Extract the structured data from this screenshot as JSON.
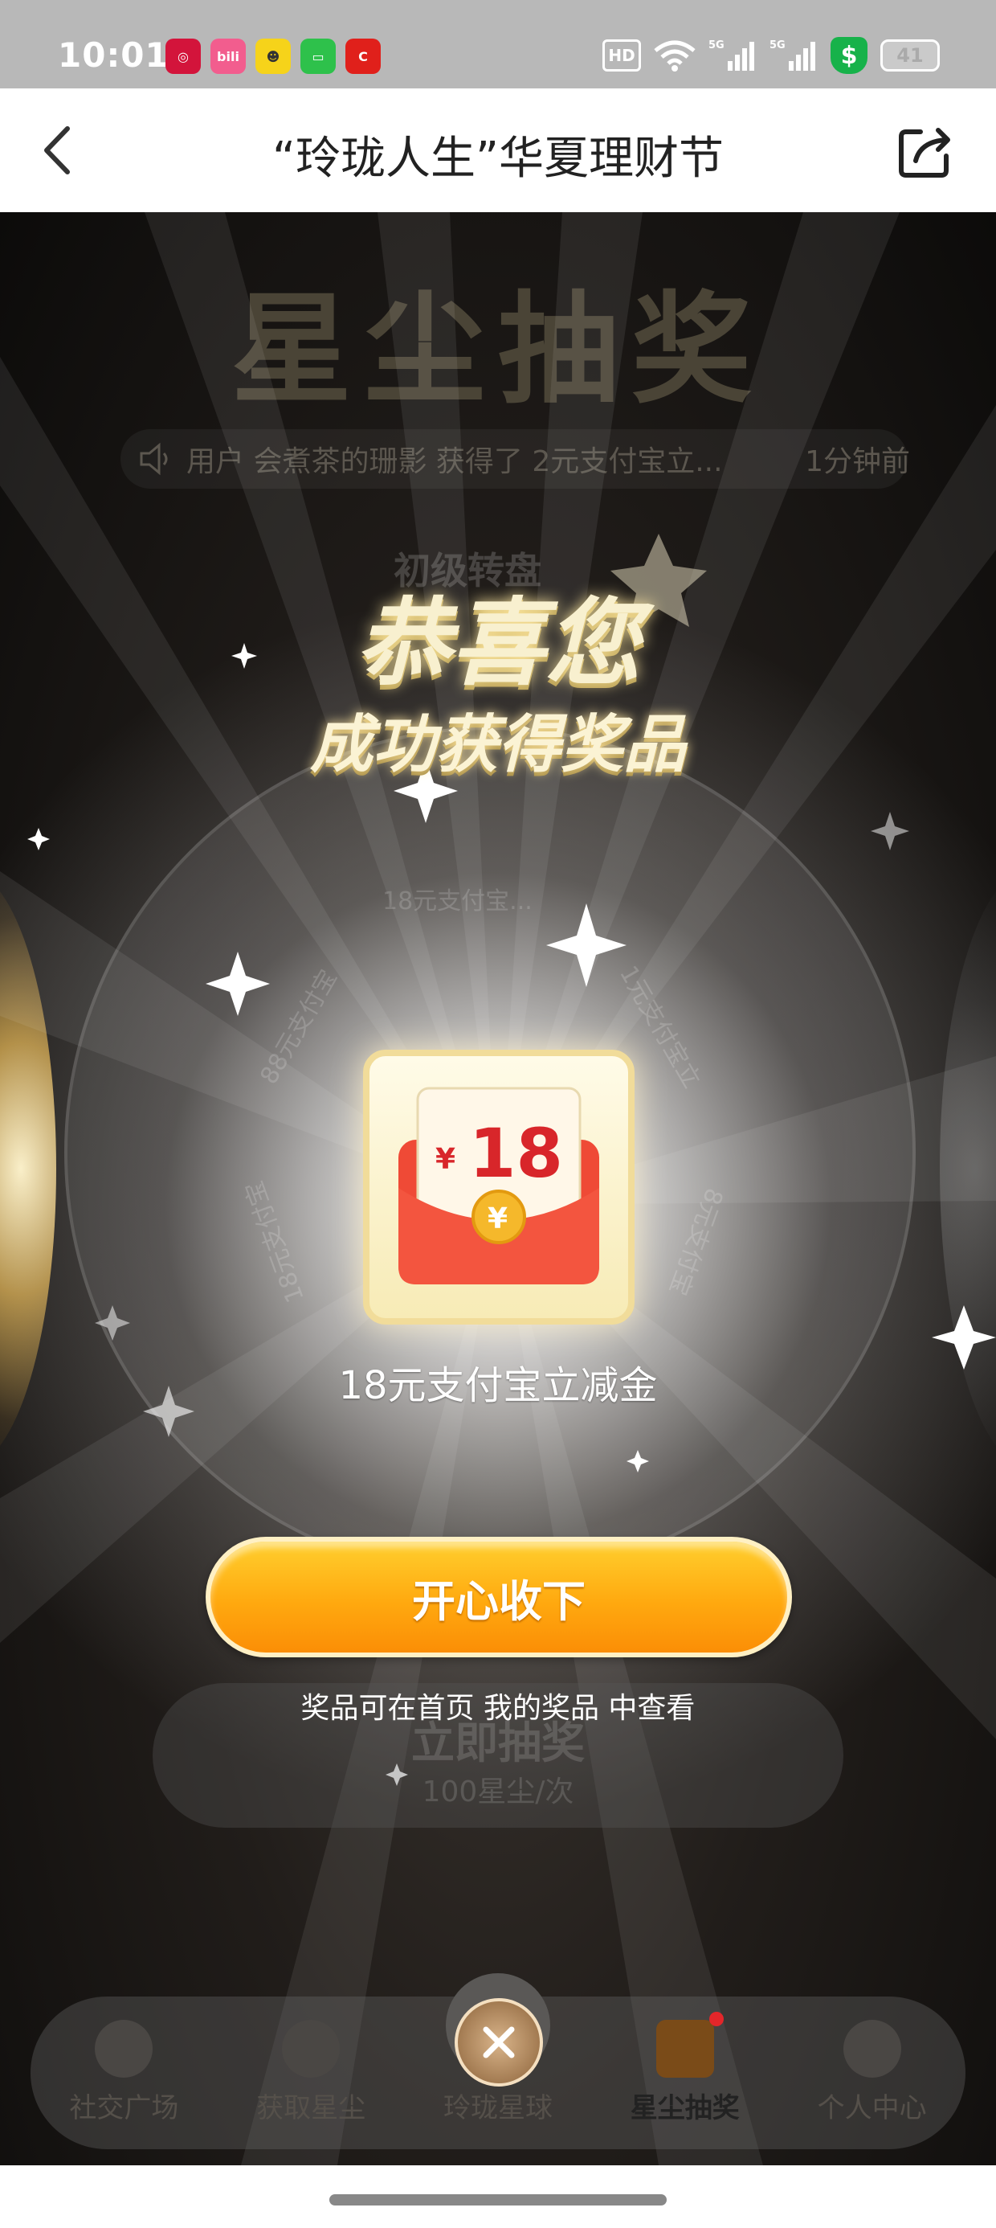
{
  "status_bar": {
    "time": "10:01",
    "notifications": [
      {
        "icon": "bank-app-icon",
        "text": "",
        "color": "#d3143b"
      },
      {
        "icon": "bilibili-icon",
        "text": "bili",
        "color": "#f25d8e"
      },
      {
        "icon": "yellow-app-icon",
        "text": "",
        "color": "#f6d31a"
      },
      {
        "icon": "message-icon",
        "text": "",
        "color": "#2ec14b"
      },
      {
        "icon": "red-app-icon",
        "text": "",
        "color": "#e0201b"
      }
    ],
    "hd": "HD",
    "network": "5G",
    "battery": "41"
  },
  "nav": {
    "title": "“玲珑人生”华夏理财节",
    "back_icon": "back-arrow-icon",
    "share_icon": "share-icon"
  },
  "game": {
    "title": "星尘抽奖",
    "ticker": {
      "message": "用户 会煮茶的珊影 获得了 2元支付宝立...",
      "time": "1分钟前"
    },
    "wheel_labels": [
      "初级转盘",
      "18元支付宝...",
      "88元支付宝",
      "1元支付宝立",
      "18元支付宝",
      "8元支付宝"
    ],
    "draw_button": {
      "label": "立即抽奖",
      "cost": "100星尘/次"
    }
  },
  "popup": {
    "congrats": "恭喜您",
    "subtitle": "成功获得奖品",
    "prize": {
      "currency": "¥",
      "amount": "18",
      "name": "18元支付宝立减金"
    },
    "accept_label": "开心收下",
    "hint": "奖品可在首页 我的奖品 中查看",
    "close_icon": "close-icon"
  },
  "tabs": [
    {
      "label": "社交广场",
      "icon": "compass-icon",
      "active": false
    },
    {
      "label": "获取星尘",
      "icon": "star-icon",
      "active": false
    },
    {
      "label": "玲珑星球",
      "icon": "planet-icon",
      "active": false
    },
    {
      "label": "星尘抽奖",
      "icon": "gift-icon",
      "active": true
    },
    {
      "label": "个人中心",
      "icon": "person-icon",
      "active": false
    }
  ],
  "colors": {
    "accent_orange": "#ffa90f",
    "gold_text": "#f8f0cf",
    "envelope_red": "#ef4a36"
  }
}
